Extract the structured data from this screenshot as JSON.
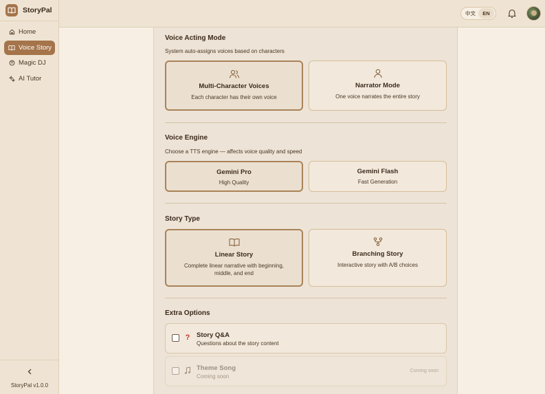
{
  "app": {
    "name": "StoryPal",
    "version": "StoryPal v1.0.0"
  },
  "sidebar": {
    "items": [
      {
        "label": "Home",
        "icon": "home-icon",
        "active": false
      },
      {
        "label": "Voice Story",
        "icon": "book-icon",
        "active": true
      },
      {
        "label": "Magic DJ",
        "icon": "disc-icon",
        "active": false
      },
      {
        "label": "AI Tutor",
        "icon": "sparkle-icon",
        "active": false
      }
    ]
  },
  "topbar": {
    "lang_zh": "中文",
    "lang_en": "EN",
    "active_lang": "EN"
  },
  "voice_acting": {
    "title": "Voice Acting Mode",
    "description": "System auto-assigns voices based on characters",
    "options": [
      {
        "title": "Multi-Character Voices",
        "desc": "Each character has their own voice",
        "icon": "users-icon",
        "selected": true
      },
      {
        "title": "Narrator Mode",
        "desc": "One voice narrates the entire story",
        "icon": "user-icon",
        "selected": false
      }
    ]
  },
  "voice_engine": {
    "title": "Voice Engine",
    "description": "Choose a TTS engine — affects voice quality and speed",
    "options": [
      {
        "title": "Gemini Pro",
        "desc": "High Quality",
        "selected": true
      },
      {
        "title": "Gemini Flash",
        "desc": "Fast Generation",
        "selected": false
      }
    ]
  },
  "story_type": {
    "title": "Story Type",
    "options": [
      {
        "title": "Linear Story",
        "desc_line1": "Complete linear narrative with beginning,",
        "desc_line2": "middle, and end",
        "icon": "open-book-icon",
        "selected": true
      },
      {
        "title": "Branching Story",
        "desc_line1": "Interactive story with A/B choices",
        "icon": "branch-icon",
        "selected": false
      }
    ]
  },
  "extra_options": {
    "title": "Extra Options",
    "items": [
      {
        "title": "Story Q&A",
        "desc": "Questions about the story content",
        "icon": "question-icon",
        "checked": false,
        "disabled": false
      },
      {
        "title": "Theme Song",
        "desc": "Coming soon",
        "badge": "Coming soon",
        "icon": "music-note-icon",
        "checked": false,
        "disabled": true
      }
    ]
  },
  "colors": {
    "accent": "#a5744a",
    "background": "#f7efe3",
    "panel": "#ede3d6",
    "border": "#d6bd98"
  }
}
